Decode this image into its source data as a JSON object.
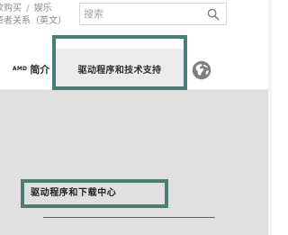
{
  "header": {
    "top_links": {
      "line1_left": "款购买",
      "line1_right": "娱乐",
      "line2": "资者关系（英文）"
    },
    "search": {
      "placeholder": "搜索"
    }
  },
  "nav": {
    "amd_badge": "AMD",
    "amd_label": "简介",
    "driver_label": "驱动程序和技术支持"
  },
  "content": {
    "driver_center_label": "驱动程序和下载中心"
  },
  "colors": {
    "highlight": "#4c7d77",
    "content_bg": "#e0e0e0",
    "active_tab_bg": "#ececec"
  },
  "icons": {
    "search": "search-icon",
    "globe": "globe-icon"
  }
}
